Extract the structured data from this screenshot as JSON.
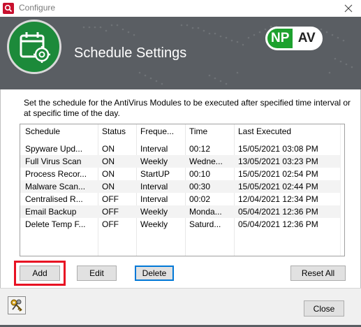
{
  "window": {
    "title": "Configure",
    "close_glyph": "✕"
  },
  "banner": {
    "heading": "Schedule Settings",
    "brand_left": "NP",
    "brand_right": "AV",
    "logo_icon": "calendar-gear-icon"
  },
  "description": "Set the schedule for the AntiVirus Modules to be executed after specified time interval or at specific time of the day.",
  "table": {
    "columns": [
      "Schedule",
      "Status",
      "Freque...",
      "Time",
      "Last Executed"
    ],
    "rows": [
      [
        "Spyware Upd...",
        "ON",
        "Interval",
        "00:12",
        "15/05/2021 03:08 PM"
      ],
      [
        "Full Virus Scan",
        "ON",
        "Weekly",
        "Wedne...",
        "13/05/2021 03:23 PM"
      ],
      [
        "Process Recor...",
        "ON",
        "StartUP",
        "00:10",
        "15/05/2021 02:54 PM"
      ],
      [
        "Malware Scan...",
        "ON",
        "Interval",
        "00:30",
        "15/05/2021 02:44 PM"
      ],
      [
        "Centralised R...",
        "OFF",
        "Interval",
        "00:02",
        "12/04/2021 12:34 PM"
      ],
      [
        "Email Backup",
        "OFF",
        "Weekly",
        "Monda...",
        "05/04/2021 12:36 PM"
      ],
      [
        "Delete Temp F...",
        "OFF",
        "Weekly",
        "Saturd...",
        "05/04/2021 12:36 PM"
      ]
    ]
  },
  "buttons": {
    "add": "Add",
    "edit": "Edit",
    "delete": "Delete",
    "reset_all": "Reset All",
    "close": "Close"
  },
  "colors": {
    "accent_red": "#e81123",
    "brand_green": "#1da12e",
    "banner_gray": "#5a5e63",
    "focus_blue": "#0078d7"
  }
}
